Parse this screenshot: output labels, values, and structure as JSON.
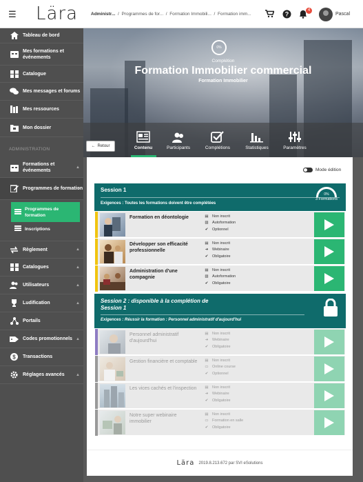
{
  "topbar": {
    "logo": "Lära",
    "breadcrumb": [
      "Administr...",
      "Programmes de for...",
      "Formation Immobili...",
      "Formation imm..."
    ],
    "notification_count": "4",
    "user_name": "Pascal"
  },
  "sidebar": {
    "items": [
      {
        "label": "Tableau de bord",
        "icon": "home-icon"
      },
      {
        "label": "Mes formations et événements",
        "icon": "calendar-icon"
      },
      {
        "label": "Catalogue",
        "icon": "grid-icon"
      },
      {
        "label": "Mes messages et forums",
        "icon": "chat-icon"
      },
      {
        "label": "Mes ressources",
        "icon": "book-icon"
      },
      {
        "label": "Mon dossier",
        "icon": "folder-icon"
      }
    ],
    "admin_header": "ADMINISTRATION",
    "admin_items": [
      {
        "label": "Formations et événements",
        "icon": "calendar-icon"
      },
      {
        "label": "Programmes de formation",
        "icon": "edit-icon"
      }
    ],
    "sub_items": [
      {
        "label": "Programmes de formation",
        "icon": "list-icon"
      },
      {
        "label": "Inscriptions",
        "icon": "list-icon"
      }
    ],
    "more_items": [
      {
        "label": "Règlement",
        "icon": "exchange-icon"
      },
      {
        "label": "Catalogues",
        "icon": "grid-icon"
      },
      {
        "label": "Utilisateurs",
        "icon": "users-icon"
      },
      {
        "label": "Ludification",
        "icon": "trophy-icon"
      },
      {
        "label": "Portails",
        "icon": "network-icon"
      },
      {
        "label": "Codes promotionnels",
        "icon": "tag-icon"
      },
      {
        "label": "Transactions",
        "icon": "dollar-icon"
      },
      {
        "label": "Réglages avancés",
        "icon": "gear-icon"
      }
    ]
  },
  "hero": {
    "completion_pct": "0%",
    "completion_label": "Complétion",
    "title": "Formation Immobilier commercial",
    "subtitle": "Formation Immobilier",
    "back_label": "Retour",
    "tabs": [
      {
        "label": "Contenu",
        "icon": "content-icon",
        "active": true
      },
      {
        "label": "Participants",
        "icon": "users-icon",
        "active": false
      },
      {
        "label": "Complétions",
        "icon": "check-icon",
        "active": false
      },
      {
        "label": "Statistiques",
        "icon": "bar-chart-icon",
        "active": false
      },
      {
        "label": "Paramètres",
        "icon": "sliders-icon",
        "active": false
      }
    ]
  },
  "content": {
    "mode_label": "Mode édition",
    "session1": {
      "title": "Session 1",
      "requirement": "Exigences : Toutes les formations doivent être complétées",
      "gauge_pct": "0%",
      "gauge_label": "3 Formations",
      "rows": [
        {
          "title": "Formation en déontologie",
          "status": "Non inscrit",
          "type": "Autoformation",
          "req": "Optionnel",
          "color": "#f1c40f"
        },
        {
          "title": "Développer son efficacité professionnelle",
          "status": "Non inscrit",
          "type": "Webinaire",
          "req": "Obligatoire",
          "color": "#f1c40f"
        },
        {
          "title": "Administration d'une compagnie",
          "status": "Non inscrit",
          "type": "Autoformation",
          "req": "Obligatoire",
          "color": "#f1c40f"
        }
      ]
    },
    "session2": {
      "title": "Session 2 : disponible à la complétion de Session 1",
      "requirement": "Exigences : Réussir la formation : Personnel administratif d'aujourd'hui",
      "rows": [
        {
          "title": "Personnel administratif d'aujourd'hui",
          "status": "Non inscrit",
          "type": "Webinaire",
          "req": "Obligatoire",
          "color": "#8e7cc3"
        },
        {
          "title": "Gestion financière et comptable",
          "status": "Non inscrit",
          "type": "Online course",
          "req": "Optionnel",
          "color": "#999999"
        },
        {
          "title": "Les vices cachés et l'inspection",
          "status": "Non inscrit",
          "type": "Webinaire",
          "req": "Obligatoire",
          "color": "#999999"
        },
        {
          "title": "Notre super webinaire immobilier",
          "status": "Non inscrit",
          "type": "Formation en salle",
          "req": "Obligatoire",
          "color": "#999999"
        }
      ]
    },
    "footer_logo": "Lära",
    "footer_text": "2019.8.213.672 par SVI eSolutions"
  },
  "colors": {
    "accent": "#2bb673",
    "session": "#0f6b6b",
    "sidebar": "#4f4f4f"
  }
}
